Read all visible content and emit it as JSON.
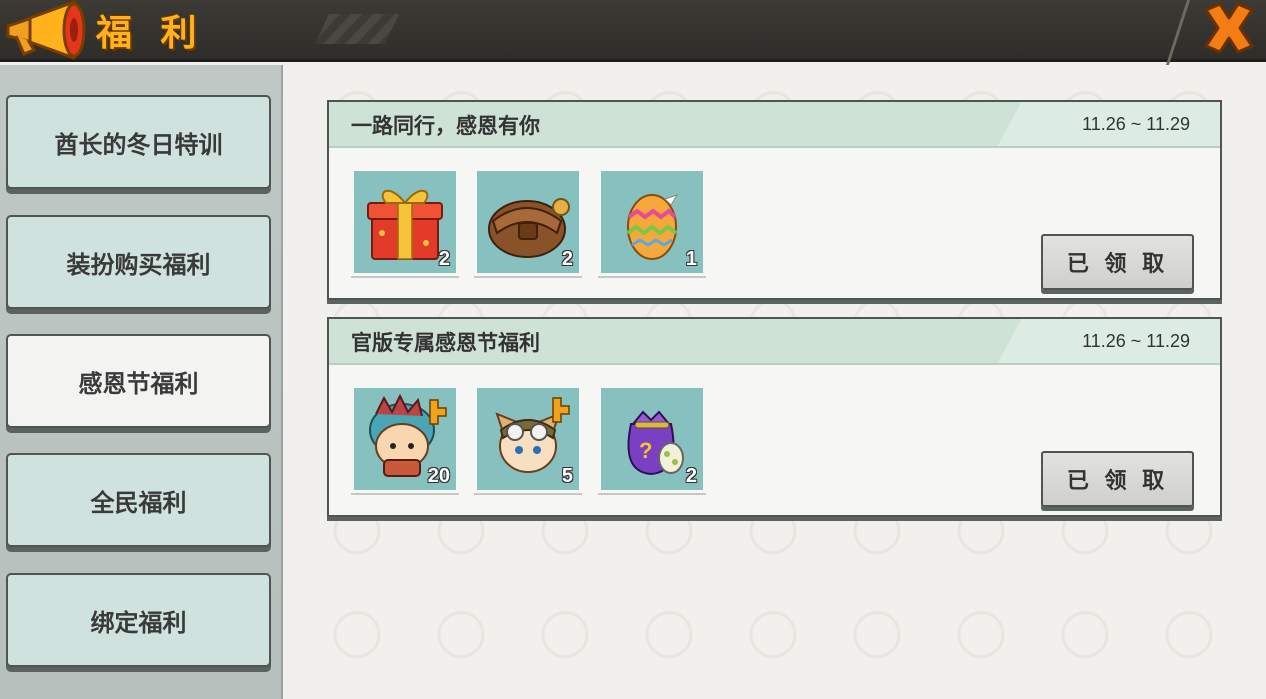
{
  "header": {
    "title": "福 利",
    "icon": "megaphone-icon",
    "close_icon": "close-icon",
    "accent_color": "#ffb21c"
  },
  "sidebar": {
    "items": [
      {
        "label": "酋长的冬日特训",
        "active": false
      },
      {
        "label": "装扮购买福利",
        "active": false
      },
      {
        "label": "感恩节福利",
        "active": true
      },
      {
        "label": "全民福利",
        "active": false
      },
      {
        "label": "绑定福利",
        "active": false
      }
    ]
  },
  "cards": [
    {
      "title": "一路同行，感恩有你",
      "date": "11.26 ~ 11.29",
      "items": [
        {
          "icon": "gift-box-icon",
          "count": "2"
        },
        {
          "icon": "backpack-icon",
          "count": "2"
        },
        {
          "icon": "easter-egg-icon",
          "count": "1"
        }
      ],
      "button": "已 领 取"
    },
    {
      "title": "官版专属感恩节福利",
      "date": "11.26 ~ 11.29",
      "items": [
        {
          "icon": "dino-avatar-icon",
          "count": "20"
        },
        {
          "icon": "fox-pilot-avatar-icon",
          "count": "5"
        },
        {
          "icon": "mystery-bag-icon",
          "count": "2"
        }
      ],
      "button": "已 领 取"
    }
  ]
}
